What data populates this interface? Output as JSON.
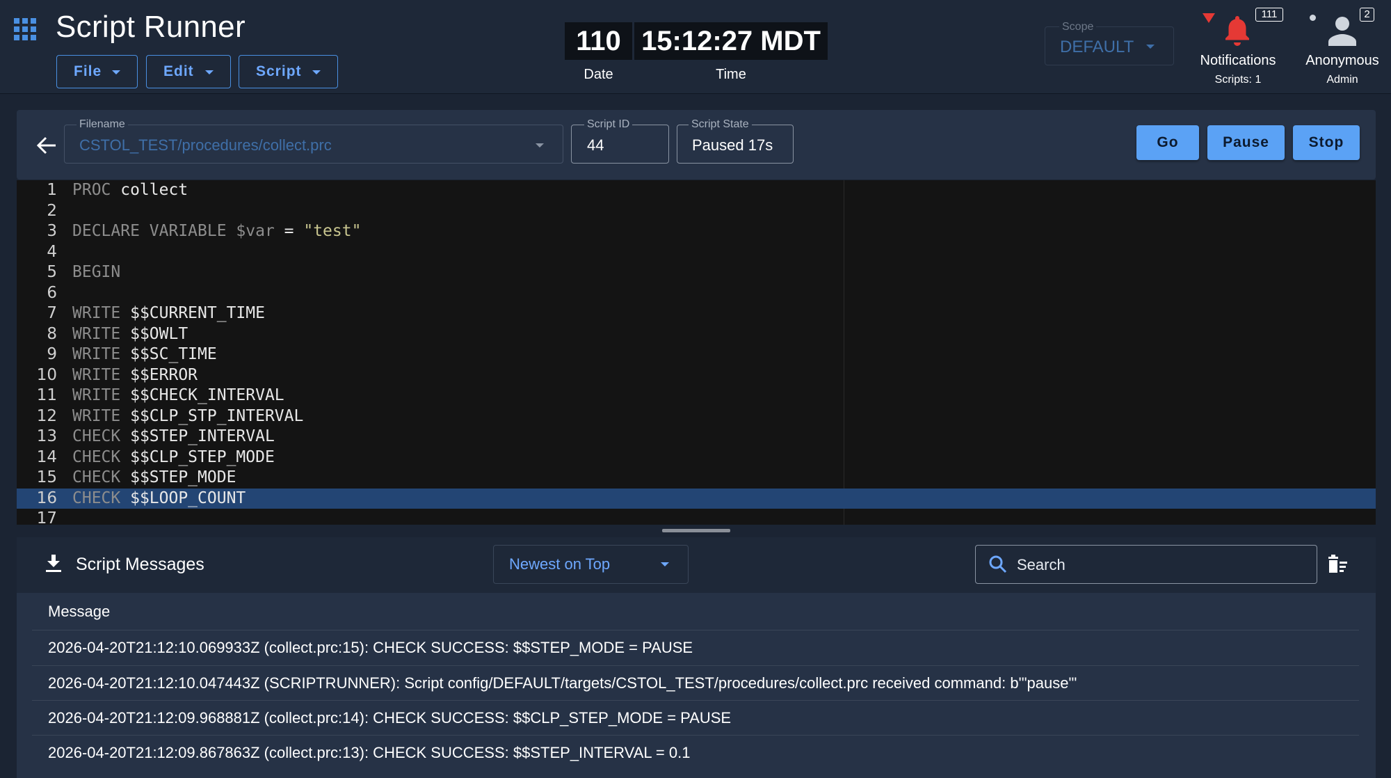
{
  "app": {
    "title": "Script Runner"
  },
  "menus": {
    "file": "File",
    "edit": "Edit",
    "script": "Script"
  },
  "clock": {
    "date_value": "110",
    "time_value": "15:12:27 MDT",
    "date_label": "Date",
    "time_label": "Time"
  },
  "scope": {
    "label": "Scope",
    "value": "DEFAULT"
  },
  "notifications": {
    "label": "Notifications",
    "sub": "Scripts: 1",
    "count": "111",
    "icon": "bell-icon",
    "alert_color": "#e53935"
  },
  "user": {
    "name": "Anonymous",
    "role": "Admin",
    "badge": "2",
    "icon": "person-icon"
  },
  "script": {
    "filename_label": "Filename",
    "filename": "CSTOL_TEST/procedures/collect.prc",
    "id_label": "Script ID",
    "id": "44",
    "state_label": "Script State",
    "state": "Paused 17s",
    "buttons": {
      "go": "Go",
      "pause": "Pause",
      "stop": "Stop"
    }
  },
  "editor": {
    "active_line": 16,
    "lines": [
      {
        "n": "1",
        "kw": "PROC",
        "rest": " collect"
      },
      {
        "n": "2",
        "kw": "",
        "rest": ""
      },
      {
        "n": "3",
        "kw": "DECLARE VARIABLE",
        "rest": " $var = ",
        "str": "\"test\""
      },
      {
        "n": "4",
        "kw": "",
        "rest": ""
      },
      {
        "n": "5",
        "kw": "BEGIN",
        "rest": ""
      },
      {
        "n": "6",
        "kw": "",
        "rest": ""
      },
      {
        "n": "7",
        "kw": "WRITE",
        "rest": " $$CURRENT_TIME"
      },
      {
        "n": "8",
        "kw": "WRITE",
        "rest": " $$OWLT"
      },
      {
        "n": "9",
        "kw": "WRITE",
        "rest": " $$SC_TIME"
      },
      {
        "n": "10",
        "kw": "WRITE",
        "rest": " $$ERROR"
      },
      {
        "n": "11",
        "kw": "WRITE",
        "rest": " $$CHECK_INTERVAL"
      },
      {
        "n": "12",
        "kw": "WRITE",
        "rest": " $$CLP_STP_INTERVAL"
      },
      {
        "n": "13",
        "kw": "CHECK",
        "rest": " $$STEP_INTERVAL"
      },
      {
        "n": "14",
        "kw": "CHECK",
        "rest": " $$CLP_STEP_MODE"
      },
      {
        "n": "15",
        "kw": "CHECK",
        "rest": " $$STEP_MODE"
      },
      {
        "n": "16",
        "kw": "CHECK",
        "rest": " $$LOOP_COUNT"
      },
      {
        "n": "17",
        "kw": "",
        "rest": ""
      }
    ]
  },
  "messages": {
    "title": "Script Messages",
    "sort": "Newest on Top",
    "search_placeholder": "Search",
    "column": "Message",
    "rows": [
      "2026-04-20T21:12:10.069933Z (collect.prc:15): CHECK SUCCESS: $$STEP_MODE = PAUSE",
      "2026-04-20T21:12:10.047443Z (SCRIPTRUNNER): Script config/DEFAULT/targets/CSTOL_TEST/procedures/collect.prc received command: b'\"pause\"'",
      "2026-04-20T21:12:09.968881Z (collect.prc:14): CHECK SUCCESS: $$CLP_STEP_MODE = PAUSE",
      "2026-04-20T21:12:09.867863Z (collect.prc:13): CHECK SUCCESS: $$STEP_INTERVAL = 0.1"
    ]
  },
  "colors": {
    "accent": "#5ba2f5",
    "highlight": "#234574",
    "background": "#1b2433"
  }
}
